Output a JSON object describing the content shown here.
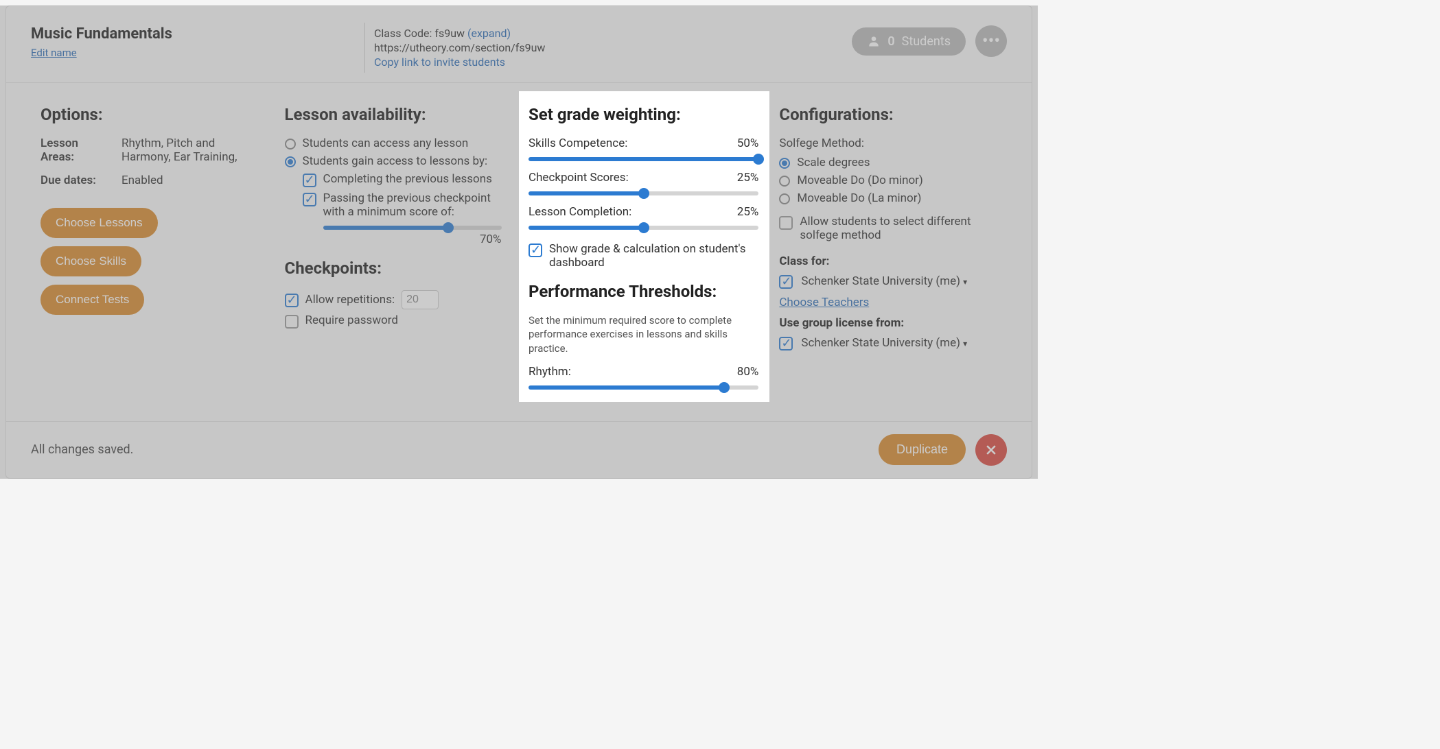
{
  "header": {
    "class_title": "Music Fundamentals",
    "edit_name": "Edit name",
    "class_code_prefix": "Class Code: ",
    "class_code": "fs9uw",
    "expand": "(expand)",
    "class_url": "https://utheory.com/section/fs9uw",
    "copy_link": "Copy link to invite students",
    "students_count": "0",
    "students_label": "Students"
  },
  "options": {
    "heading": "Options:",
    "rows": [
      {
        "label": "Lesson Areas:",
        "value": "Rhythm, Pitch and Harmony, Ear Training,"
      },
      {
        "label": "Due dates:",
        "value": "Enabled"
      }
    ],
    "buttons": {
      "choose_lessons": "Choose Lessons",
      "choose_skills": "Choose Skills",
      "connect_tests": "Connect Tests"
    }
  },
  "availability": {
    "heading": "Lesson availability:",
    "radio1": "Students can access any lesson",
    "radio2": "Students gain access to lessons by:",
    "check_prev_lessons": "Completing the previous lessons",
    "check_prev_checkpoint": "Passing the previous checkpoint with a minimum score of:",
    "min_score_pct": 70,
    "min_score_label": "70%"
  },
  "checkpoints": {
    "heading": "Checkpoints:",
    "allow_repetitions": "Allow repetitions:",
    "repetitions_value": "20",
    "require_password": "Require password"
  },
  "weighting": {
    "heading": "Set grade weighting:",
    "sliders": [
      {
        "label": "Skills Competence:",
        "pct": 50,
        "pct_label": "50%"
      },
      {
        "label": "Checkpoint Scores:",
        "pct": 25,
        "pct_label": "25%"
      },
      {
        "label": "Lesson Completion:",
        "pct": 25,
        "pct_label": "25%"
      }
    ],
    "show_grade_label": "Show grade & calculation on student's dashboard"
  },
  "thresholds": {
    "heading": "Performance Thresholds:",
    "description": "Set the minimum required score to complete performance exercises in lessons and skills practice.",
    "rhythm_label": "Rhythm:",
    "rhythm_pct": 80,
    "rhythm_pct_label": "80%"
  },
  "config": {
    "heading": "Configurations:",
    "solfege_label": "Solfege Method:",
    "solfege_options": [
      {
        "label": "Scale degrees",
        "checked": true
      },
      {
        "label": "Moveable Do (Do minor)",
        "checked": false
      },
      {
        "label": "Moveable Do (La minor)",
        "checked": false
      }
    ],
    "allow_diff_solfege": "Allow students to select different solfege method",
    "class_for_label": "Class for:",
    "class_for_value": "Schenker State University (me)",
    "choose_teachers": "Choose Teachers",
    "license_label": "Use group license from:",
    "license_value": "Schenker State University (me)"
  },
  "footer": {
    "status": "All changes saved.",
    "duplicate": "Duplicate"
  }
}
